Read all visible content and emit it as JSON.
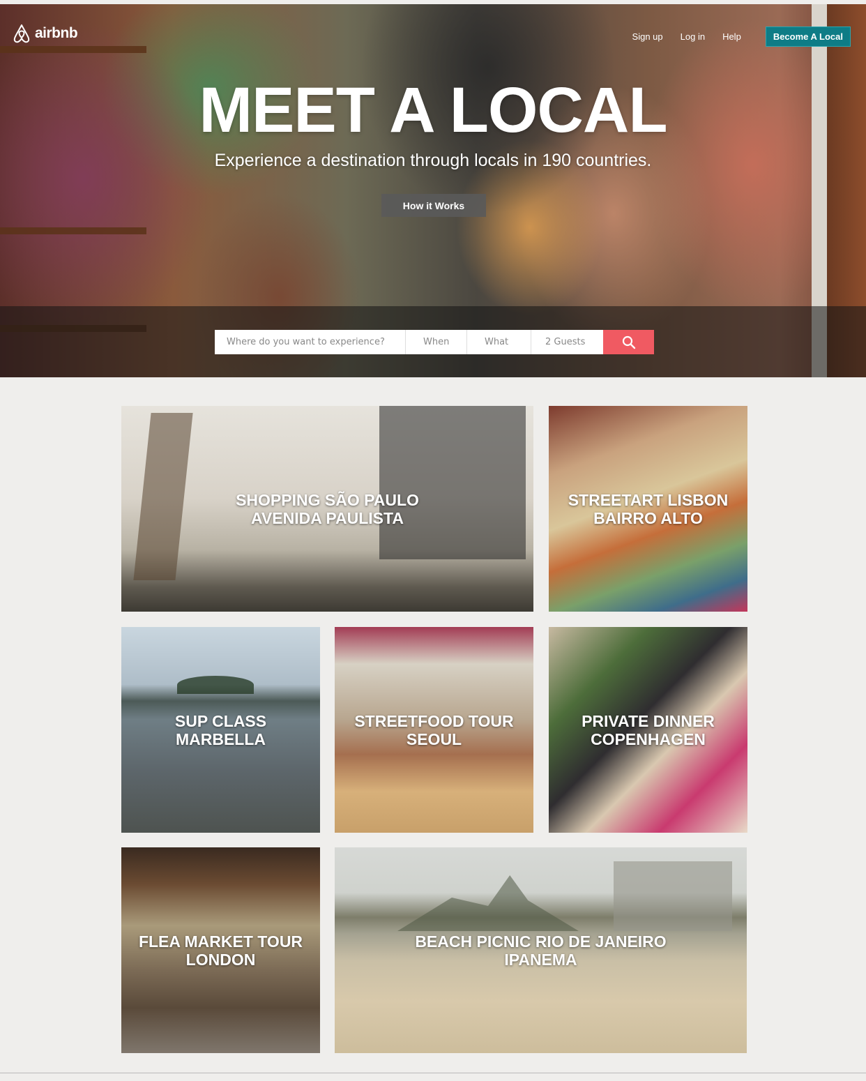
{
  "brand": {
    "name": "airbnb",
    "color": "#ff5a5f"
  },
  "nav": {
    "signup": "Sign up",
    "login": "Log in",
    "help": "Help",
    "become": "Become A Local",
    "become_color": "#0e7c86"
  },
  "hero": {
    "title": "MEET A LOCAL",
    "subtitle": "Experience a destination through locals in 190 countries.",
    "cta": "How it Works"
  },
  "search": {
    "where_placeholder": "Where do you want to experience?",
    "when": "When",
    "what": "What",
    "guests": "2 Guests",
    "button_icon": "search-icon",
    "button_color": "#f05a62"
  },
  "experiences": [
    {
      "line1": "SHOPPING SÃO PAULO",
      "line2": "AVENIDA PAULISTA"
    },
    {
      "line1": "STREETART LISBON",
      "line2": "BAIRRO ALTO"
    },
    {
      "line1": "SUP CLASS",
      "line2": "MARBELLA"
    },
    {
      "line1": "STREETFOOD TOUR",
      "line2": "SEOUL"
    },
    {
      "line1": "PRIVATE DINNER",
      "line2": "COPENHAGEN"
    },
    {
      "line1": "FLEA MARKET TOUR",
      "line2": "LONDON"
    },
    {
      "line1": "BEACH PICNIC RIO DE JANEIRO",
      "line2": "IPANEMA"
    }
  ]
}
